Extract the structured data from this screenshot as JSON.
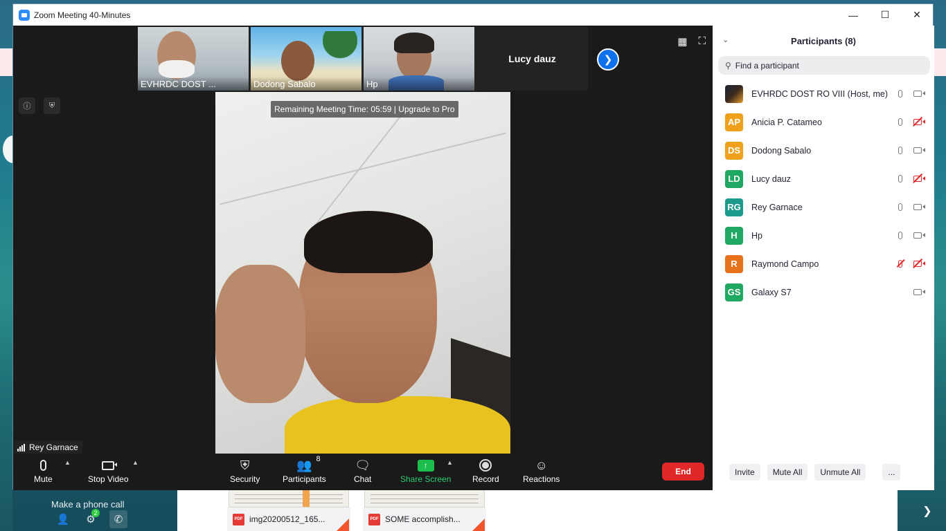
{
  "window": {
    "title": "Zoom Meeting 40-Minutes"
  },
  "strip": {
    "thumbnails": [
      {
        "name": "EVHRDC DOST ..."
      },
      {
        "name": "Dodong Sabalo"
      },
      {
        "name": "Hp"
      }
    ],
    "text_only_name": "Lucy dauz"
  },
  "banner": {
    "remaining": "Remaining Meeting Time: 05:59 | Upgrade to Pro"
  },
  "active_speaker": {
    "name": "Rey Garnace"
  },
  "toolbar": {
    "mute": "Mute",
    "stop_video": "Stop Video",
    "security": "Security",
    "participants": "Participants",
    "participants_count": "8",
    "chat": "Chat",
    "share_screen": "Share Screen",
    "record": "Record",
    "reactions": "Reactions",
    "end": "End"
  },
  "panel": {
    "title": "Participants (8)",
    "search_placeholder": "Find a participant",
    "participants": [
      {
        "initials": "",
        "name": "EVHRDC DOST RO VIII (Host, me)",
        "color": "#1c2530",
        "mic_muted": false,
        "video_off": false,
        "has_mic": true
      },
      {
        "initials": "AP",
        "name": "Anicia P. Catameo",
        "color": "#f0a11c",
        "mic_muted": false,
        "video_off": true,
        "has_mic": true
      },
      {
        "initials": "DS",
        "name": "Dodong Sabalo",
        "color": "#f0a11c",
        "mic_muted": false,
        "video_off": false,
        "has_mic": true
      },
      {
        "initials": "LD",
        "name": "Lucy dauz",
        "color": "#1fa861",
        "mic_muted": false,
        "video_off": true,
        "has_mic": true
      },
      {
        "initials": "RG",
        "name": "Rey Garnace",
        "color": "#1c9a8a",
        "mic_muted": false,
        "video_off": false,
        "has_mic": true
      },
      {
        "initials": "H",
        "name": "Hp",
        "color": "#1fa861",
        "mic_muted": false,
        "video_off": false,
        "has_mic": true
      },
      {
        "initials": "R",
        "name": "Raymond Campo",
        "color": "#e8711b",
        "mic_muted": true,
        "video_off": true,
        "has_mic": true
      },
      {
        "initials": "GS",
        "name": "Galaxy S7",
        "color": "#1fa861",
        "mic_muted": false,
        "video_off": false,
        "has_mic": false
      }
    ],
    "footer": {
      "invite": "Invite",
      "mute_all": "Mute All",
      "unmute_all": "Unmute All",
      "more": "..."
    }
  },
  "desktop": {
    "phone_call": "Make a phone call",
    "phone_badge": "2",
    "downloads": [
      {
        "name": "img20200512_165..."
      },
      {
        "name": "SOME accomplish..."
      }
    ],
    "pdf_label": "PDF"
  }
}
